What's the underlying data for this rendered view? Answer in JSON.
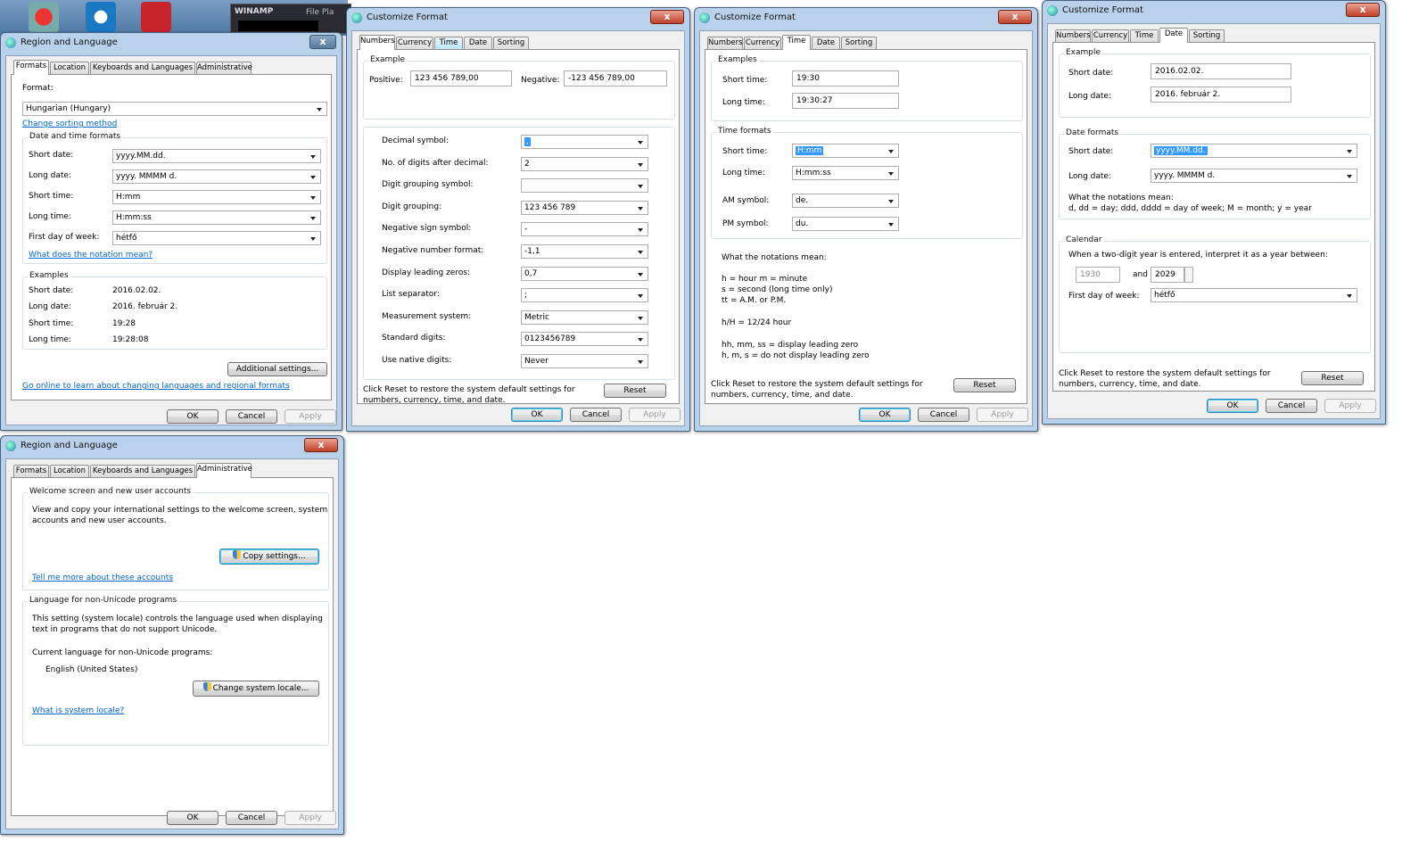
{
  "winamp": {
    "title": "WINAMP",
    "menu": "File   Pla"
  },
  "ra1": {
    "title": "Region and Language",
    "close": "x",
    "tabs": [
      "Formats",
      "Location",
      "Keyboards and Languages",
      "Administrative"
    ],
    "format_label": "Format:",
    "format_value": "Hungarian (Hungary)",
    "change_sorting": "Change sorting method",
    "dt_group": "Date and time formats",
    "rows": [
      {
        "label": "Short date:",
        "value": "yyyy.MM.dd."
      },
      {
        "label": "Long date:",
        "value": "yyyy. MMMM d."
      },
      {
        "label": "Short time:",
        "value": "H:mm"
      },
      {
        "label": "Long time:",
        "value": "H:mm:ss"
      },
      {
        "label": "First day of week:",
        "value": "hétfő"
      }
    ],
    "notation_link": "What does the notation mean?",
    "examples_group": "Examples",
    "examples": [
      {
        "label": "Short date:",
        "value": "2016.02.02."
      },
      {
        "label": "Long date:",
        "value": "2016. február 2."
      },
      {
        "label": "Short time:",
        "value": "19:28"
      },
      {
        "label": "Long time:",
        "value": "19:28:08"
      }
    ],
    "additional": "Additional settings...",
    "online_link": "Go online to learn about changing languages and regional formats",
    "ok": "OK",
    "cancel": "Cancel",
    "apply": "Apply"
  },
  "ra2": {
    "title": "Region and Language",
    "close": "x",
    "tabs": [
      "Formats",
      "Location",
      "Keyboards and Languages",
      "Administrative"
    ],
    "welcome_group": "Welcome screen and new user accounts",
    "welcome_text1": "View and copy your international settings to the welcome screen, system",
    "welcome_text2": "accounts and new user accounts.",
    "copy_btn": "Copy settings...",
    "tell_link": "Tell me more about these accounts",
    "nonuni_group": "Language for non-Unicode programs",
    "nonuni_text1": "This setting (system locale) controls the language used when displaying",
    "nonuni_text2": "text in programs that do not support Unicode.",
    "current_label": "Current language for non-Unicode programs:",
    "current_value": "English (United States)",
    "change_btn": "Change system locale...",
    "locale_link": "What is system locale?",
    "ok": "OK",
    "cancel": "Cancel",
    "apply": "Apply"
  },
  "cf1": {
    "title": "Customize Format",
    "close": "x",
    "tabs": [
      "Numbers",
      "Currency",
      "Time",
      "Date",
      "Sorting"
    ],
    "example_group": "Example",
    "positive_label": "Positive:",
    "positive_value": "123 456 789,00",
    "negative_label": "Negative:",
    "negative_value": "-123 456 789,00",
    "rows": [
      {
        "label": "Decimal symbol:",
        "value": ","
      },
      {
        "label": "No. of digits after decimal:",
        "value": "2"
      },
      {
        "label": "Digit grouping symbol:",
        "value": ""
      },
      {
        "label": "Digit grouping:",
        "value": "123 456 789"
      },
      {
        "label": "Negative sign symbol:",
        "value": "-"
      },
      {
        "label": "Negative number format:",
        "value": "-1,1"
      },
      {
        "label": "Display leading zeros:",
        "value": "0,7"
      },
      {
        "label": "List separator:",
        "value": ";"
      },
      {
        "label": "Measurement system:",
        "value": "Metric"
      },
      {
        "label": "Standard digits:",
        "value": "0123456789"
      },
      {
        "label": "Use native digits:",
        "value": "Never"
      }
    ],
    "reset_text1": "Click Reset to restore the system default settings for",
    "reset_text2": "numbers, currency, time, and date.",
    "reset": "Reset",
    "ok": "OK",
    "cancel": "Cancel",
    "apply": "Apply"
  },
  "cf2": {
    "title": "Customize Format",
    "close": "x",
    "tabs": [
      "Numbers",
      "Currency",
      "Time",
      "Date",
      "Sorting"
    ],
    "examples_group": "Examples",
    "short_label": "Short time:",
    "short_value": "19:30",
    "long_label": "Long time:",
    "long_value": "19:30:27",
    "formats_group": "Time formats",
    "rows": [
      {
        "label": "Short time:",
        "value": "H:mm"
      },
      {
        "label": "Long time:",
        "value": "H:mm:ss"
      },
      {
        "label": "AM symbol:",
        "value": "de."
      },
      {
        "label": "PM symbol:",
        "value": "du."
      }
    ],
    "notations": [
      "What the notations mean:",
      "h = hour   m = minute",
      "s = second (long time only)",
      "tt = A.M. or P.M.",
      "h/H = 12/24 hour",
      "hh, mm, ss = display leading zero",
      "h, m, s = do not display leading zero"
    ],
    "reset_text1": "Click Reset to restore the system default settings for",
    "reset_text2": "numbers, currency, time, and date.",
    "reset": "Reset",
    "ok": "OK",
    "cancel": "Cancel",
    "apply": "Apply"
  },
  "cf3": {
    "title": "Customize Format",
    "close": "x",
    "tabs": [
      "Numbers",
      "Currency",
      "Time",
      "Date",
      "Sorting"
    ],
    "example_group": "Example",
    "short_label": "Short date:",
    "short_value": "2016.02.02.",
    "long_label": "Long date:",
    "long_value": "2016. február 2.",
    "formats_group": "Date formats",
    "rows": [
      {
        "label": "Short date:",
        "value": "yyyy.MM.dd."
      },
      {
        "label": "Long date:",
        "value": "yyyy. MMMM d."
      }
    ],
    "notation1": "What the notations mean:",
    "notation2": "d, dd = day;  ddd, dddd = day of week;  M = month;  y = year",
    "calendar_group": "Calendar",
    "two_digit": "When a two-digit year is entered, interpret it as a year between:",
    "year_from": "1930",
    "and": "and",
    "year_to": "2029",
    "first_day_label": "First day of week:",
    "first_day_value": "hétfő",
    "reset_text1": "Click Reset to restore the system default settings for",
    "reset_text2": "numbers, currency, time, and date.",
    "reset": "Reset",
    "ok": "OK",
    "cancel": "Cancel",
    "apply": "Apply"
  }
}
